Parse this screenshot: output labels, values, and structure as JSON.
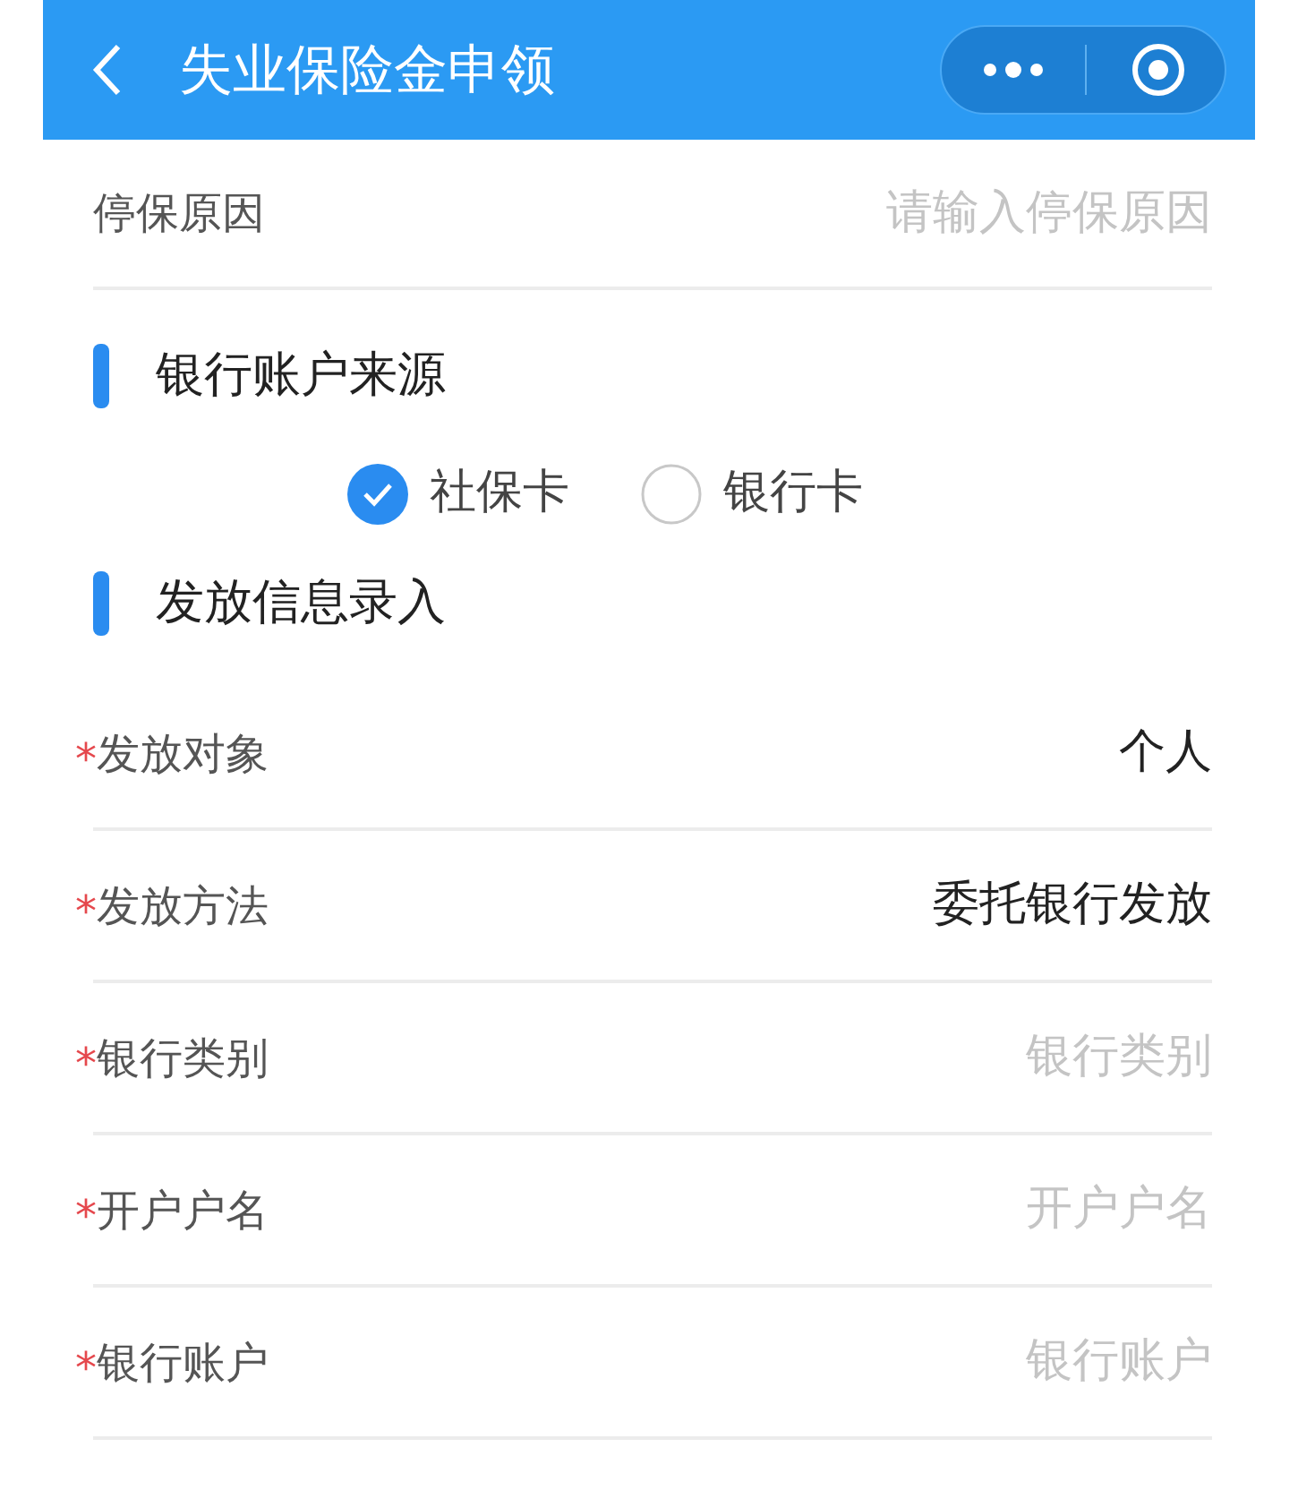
{
  "header": {
    "title": "失业保险金申领"
  },
  "top_field": {
    "label": "停保原因",
    "placeholder": "请输入停保原因"
  },
  "account_source": {
    "title": "银行账户来源",
    "options": [
      {
        "label": "社保卡",
        "selected": true
      },
      {
        "label": "银行卡",
        "selected": false
      }
    ]
  },
  "payment": {
    "title": "发放信息录入",
    "fields": [
      {
        "required_mark": "*",
        "label": "发放对象",
        "value": "个人"
      },
      {
        "required_mark": "*",
        "label": "发放方法",
        "value": "委托银行发放"
      },
      {
        "required_mark": "*",
        "label": "银行类别",
        "placeholder": "银行类别"
      },
      {
        "required_mark": "*",
        "label": "开户户名",
        "placeholder": "开户户名"
      },
      {
        "required_mark": "*",
        "label": "银行账户",
        "placeholder": "银行账户"
      }
    ]
  }
}
